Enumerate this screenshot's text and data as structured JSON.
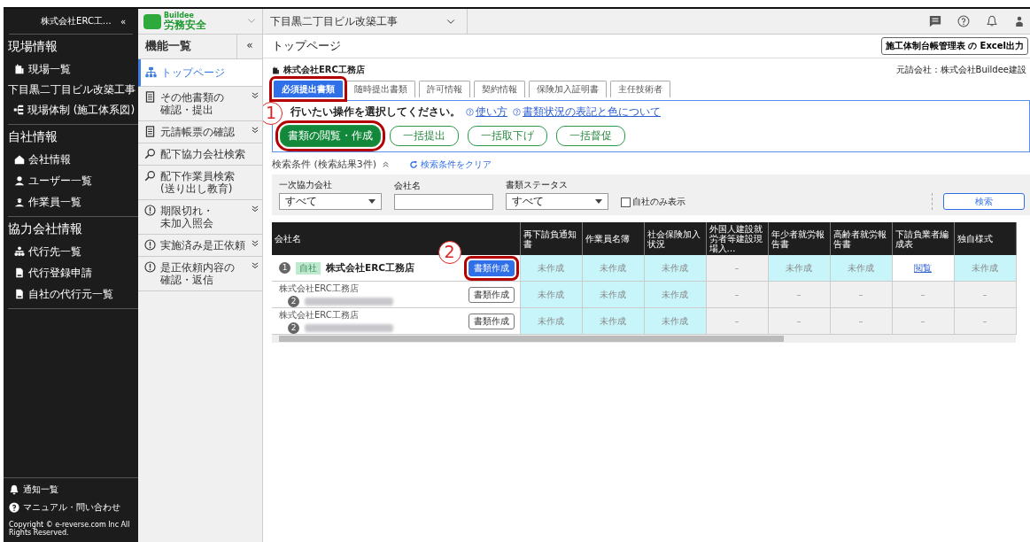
{
  "sidebar": {
    "company": "株式会社ERC工…",
    "collapse": "«",
    "sections": [
      {
        "title": "現場情報",
        "items": [
          {
            "label": "現場一覧"
          },
          {
            "label": "下目黒二丁目ビル改築工事",
            "children": [
              {
                "label": "現場体制 (施工体系図)"
              }
            ]
          }
        ]
      },
      {
        "title": "自社情報",
        "items": [
          {
            "label": "会社情報"
          },
          {
            "label": "ユーザー一覧"
          },
          {
            "label": "作業員一覧"
          }
        ]
      },
      {
        "title": "協力会社情報",
        "items": [
          {
            "label": "代行先一覧"
          },
          {
            "label": "代行登録申請"
          },
          {
            "label": "自社の代行元一覧"
          }
        ]
      }
    ],
    "footer": [
      {
        "label": "通知一覧"
      },
      {
        "label": "マニュアル・問い合わせ"
      }
    ],
    "copyright": "Copyright © e-reverse.com Inc All Rights Reserved."
  },
  "nav": {
    "logo_small": "Buildee",
    "logo": "労務安全",
    "title": "機能一覧",
    "collapse": "«",
    "items": [
      {
        "lines": [
          "トップページ"
        ],
        "selected": true,
        "expandable": false
      },
      {
        "lines": [
          "その他書類の",
          "確認・提出"
        ],
        "selected": false,
        "expandable": true
      },
      {
        "lines": [
          "元請帳票の確認"
        ],
        "selected": false,
        "expandable": true
      },
      {
        "lines": [
          "配下協力会社検索"
        ],
        "selected": false,
        "expandable": false
      },
      {
        "lines": [
          "配下作業員検索",
          "(送り出し教育)"
        ],
        "selected": false,
        "expandable": false
      },
      {
        "lines": [
          "期限切れ・",
          "未加入照会"
        ],
        "selected": false,
        "expandable": true
      },
      {
        "lines": [
          "実施済み是正依頼"
        ],
        "selected": false,
        "expandable": true
      },
      {
        "lines": [
          "是正依頼内容の",
          "確認・返信"
        ],
        "selected": false,
        "expandable": true
      }
    ]
  },
  "topbar": {
    "project": "下目黒二丁目ビル改築工事"
  },
  "main": {
    "title": "トップページ",
    "export_button": "施工体制台帳管理表 の Excel出力",
    "company": "株式会社ERC工務店",
    "prime_contractor": "元請会社：株式会社Buildee建設",
    "tabs": [
      {
        "label": "必須提出書類",
        "selected": true,
        "highlight": true,
        "callout": "1"
      },
      {
        "label": "随時提出書類",
        "selected": false,
        "highlight": false
      },
      {
        "label": "許可情報",
        "selected": false,
        "highlight": false
      },
      {
        "label": "契約情報",
        "selected": false,
        "highlight": false
      },
      {
        "label": "保険加入証明書",
        "selected": false,
        "highlight": false
      },
      {
        "label": "主任技術者",
        "selected": false,
        "highlight": false
      }
    ],
    "instruction": "行いたい操作を選択してください。",
    "help_links": [
      "使い方",
      "書類状況の表記と色について"
    ],
    "actions": [
      {
        "label": "書類の閲覧・作成",
        "kind": "primary",
        "highlight": true
      },
      {
        "label": "一括提出",
        "kind": "outline",
        "highlight": false
      },
      {
        "label": "一括取下げ",
        "kind": "outline",
        "highlight": false
      },
      {
        "label": "一括督促",
        "kind": "outline",
        "highlight": false
      }
    ],
    "search": {
      "title": "検索条件 (検索結果3件)",
      "clear": "検索条件をクリア",
      "expanded": true,
      "fields": [
        {
          "label": "一次協力会社",
          "kind": "select",
          "value": "すべて"
        },
        {
          "label": "会社名",
          "kind": "text"
        },
        {
          "label": "書類ステータス",
          "kind": "select",
          "value": "すべて"
        }
      ],
      "own_only": {
        "label": "自社のみ表示",
        "checked": false
      },
      "button": "検索"
    },
    "table": {
      "name_column": "会社名",
      "document_columns": [
        "再下請負通知書",
        "作業員名簿",
        "社会保険加入状況",
        "外国人建設就労者等建設現場入…",
        "年少者就労報告書",
        "高齢者就労報告書",
        "下請負業者編成表",
        "独自様式"
      ],
      "rows": [
        {
          "level": "1",
          "tag": "自社",
          "name": "株式会社ERC工務店",
          "redacted": false,
          "button": {
            "label": "書類作成",
            "kind": "primary",
            "highlight": true,
            "callout": "2"
          },
          "documents": [
            {
              "text": "未作成",
              "kind": "pending"
            },
            {
              "text": "未作成",
              "kind": "pending"
            },
            {
              "text": "未作成",
              "kind": "pending"
            },
            {
              "text": "–",
              "kind": "na"
            },
            {
              "text": "未作成",
              "kind": "pending"
            },
            {
              "text": "未作成",
              "kind": "pending"
            },
            {
              "text": "閲覧",
              "kind": "link"
            },
            {
              "text": "未作成",
              "kind": "pending"
            }
          ]
        },
        {
          "parent": "株式会社ERC工務店",
          "level": "2",
          "redacted": true,
          "button": {
            "label": "書類作成",
            "kind": "outline",
            "highlight": false
          },
          "documents": [
            {
              "text": "未作成",
              "kind": "pending"
            },
            {
              "text": "未作成",
              "kind": "pending"
            },
            {
              "text": "未作成",
              "kind": "pending"
            },
            {
              "text": "–",
              "kind": "na"
            },
            {
              "text": "–",
              "kind": "na"
            },
            {
              "text": "–",
              "kind": "na"
            },
            {
              "text": "–",
              "kind": "na"
            },
            {
              "text": "–",
              "kind": "na"
            }
          ]
        },
        {
          "parent": "株式会社ERC工務店",
          "level": "2",
          "redacted": true,
          "button": {
            "label": "書類作成",
            "kind": "outline",
            "highlight": false
          },
          "documents": [
            {
              "text": "未作成",
              "kind": "pending"
            },
            {
              "text": "未作成",
              "kind": "pending"
            },
            {
              "text": "未作成",
              "kind": "pending"
            },
            {
              "text": "–",
              "kind": "na"
            },
            {
              "text": "–",
              "kind": "na"
            },
            {
              "text": "–",
              "kind": "na"
            },
            {
              "text": "–",
              "kind": "na"
            },
            {
              "text": "–",
              "kind": "na"
            }
          ]
        }
      ]
    }
  }
}
